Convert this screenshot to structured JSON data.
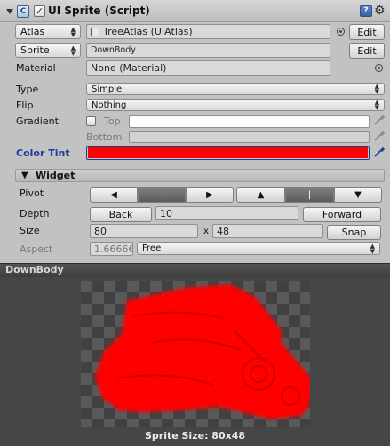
{
  "component": {
    "title": "UI Sprite (Script)",
    "enabled_check": "✓",
    "script_icon": "C",
    "help_icon": "?"
  },
  "atlas": {
    "dropdown_label": "Atlas",
    "value": "TreeAtlas (UIAtlas)",
    "edit_label": "Edit"
  },
  "sprite": {
    "dropdown_label": "Sprite",
    "value": "DownBody",
    "edit_label": "Edit"
  },
  "material": {
    "label": "Material",
    "value": "None (Material)"
  },
  "type": {
    "label": "Type",
    "value": "Simple"
  },
  "flip": {
    "label": "Flip",
    "value": "Nothing"
  },
  "gradient": {
    "label": "Gradient",
    "top_label": "Top",
    "bottom_label": "Bottom",
    "enabled": false
  },
  "color_tint": {
    "label": "Color Tint",
    "color": "#ff0000"
  },
  "widget": {
    "header": "Widget",
    "pivot_label": "Pivot",
    "pivot_h": [
      "◀",
      "—",
      "▶"
    ],
    "pivot_v": [
      "▲",
      "|",
      "▼"
    ],
    "pivot_h_selected": 1,
    "pivot_v_selected": 1,
    "depth_label": "Depth",
    "depth_back": "Back",
    "depth_value": "10",
    "depth_forward": "Forward",
    "size_label": "Size",
    "width": "80",
    "height": "48",
    "size_sep": "x",
    "snap_label": "Snap",
    "aspect_label": "Aspect",
    "aspect_value": "1.66666",
    "aspect_mode": "Free"
  },
  "preview": {
    "title": "DownBody",
    "caption": "Sprite Size: 80x48",
    "sprite_color": "#ff0000",
    "checker_light": "#595959",
    "checker_dark": "#414141"
  },
  "icons": [
    "fold-arrow-icon",
    "script-icon",
    "help-book-icon",
    "gear-icon",
    "atlas-icon",
    "object-picker-icon",
    "eyedropper-icon"
  ]
}
